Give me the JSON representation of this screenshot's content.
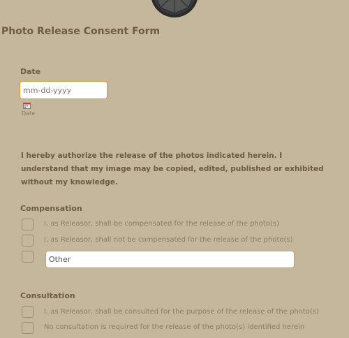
{
  "form": {
    "title": "Photo Release Consent Form"
  },
  "date_field": {
    "label": "Date",
    "placeholder": "mm-dd-yyyy",
    "sublabel": "Date",
    "icon": "calendar-icon"
  },
  "authorization": {
    "text": "I hereby authorize the release of the photos indicated herein. I understand that my image may be copied, edited, published or exhibited without my knowledge."
  },
  "compensation": {
    "label": "Compensation",
    "options": [
      "I, as Releasor, shall be compensated for the release of the photo(s)",
      "I, as Releasor, shall not be compensated for the release of the photo(s)"
    ],
    "other_value": "Other"
  },
  "consultation": {
    "label": "Consultation",
    "options": [
      "I, as Releasor, shall be consulted for the purpose of the release of the photo(s)",
      "No consultation is required for the release of the photo(s) identified herein"
    ]
  },
  "colors": {
    "background": "#c4b79b",
    "accent": "#e8962f",
    "text": "#6e5c3f"
  }
}
